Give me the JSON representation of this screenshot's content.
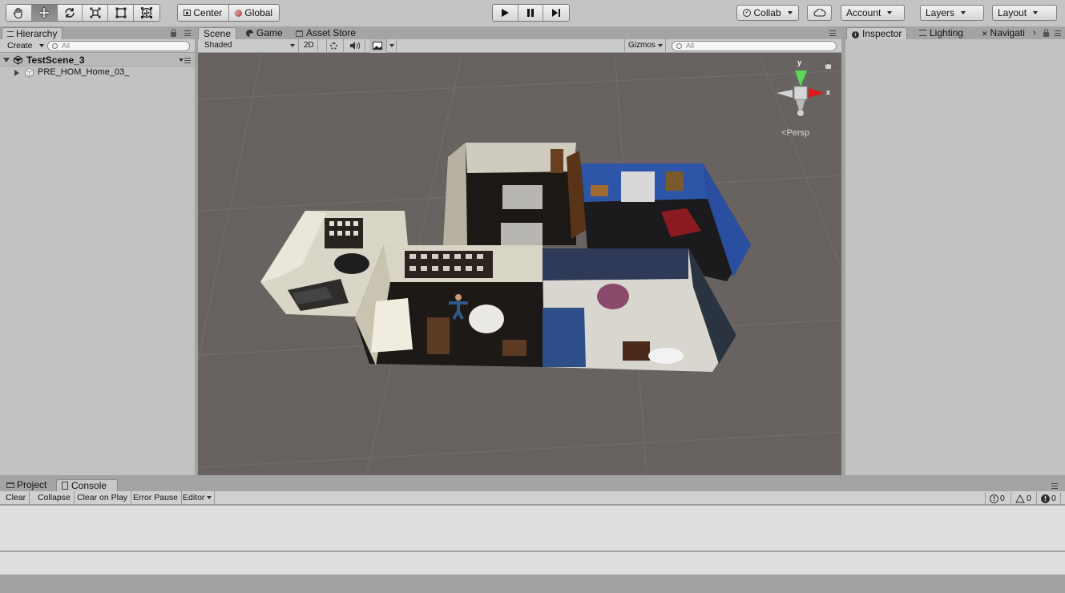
{
  "toolbar": {
    "tools": [
      "hand-tool",
      "move-tool",
      "rotate-tool",
      "scale-tool",
      "rect-tool",
      "transform-tool"
    ],
    "active_tool": "move-tool",
    "pivot_mode": "Center",
    "pivot_rotation": "Global",
    "collab_label": "Collab",
    "account_label": "Account",
    "layers_label": "Layers",
    "layout_label": "Layout"
  },
  "hierarchy": {
    "tab_label": "Hierarchy",
    "create_label": "Create",
    "search_placeholder": "All",
    "scene_name": "TestScene_3",
    "items": [
      {
        "label": "PRE_HOM_Home_03_"
      }
    ]
  },
  "scene_tabs": [
    {
      "label": "Scene",
      "icon": "scene-icon",
      "active": true
    },
    {
      "label": "Game",
      "icon": "game-icon",
      "active": false
    },
    {
      "label": "Asset Store",
      "icon": "asset-store-icon",
      "active": false
    }
  ],
  "scene_toolbar": {
    "shading_mode": "Shaded",
    "mode_2d": "2D",
    "gizmos_label": "Gizmos",
    "search_placeholder": "All"
  },
  "gizmo": {
    "y_label": "y",
    "x_label": "x",
    "projection_label": "Persp"
  },
  "inspector_tabs": [
    {
      "label": "Inspector",
      "active": true
    },
    {
      "label": "Lighting",
      "active": false
    },
    {
      "label": "Navigati",
      "active": false
    }
  ],
  "bottom_tabs": [
    {
      "label": "Project",
      "active": false
    },
    {
      "label": "Console",
      "active": true
    }
  ],
  "console": {
    "clear": "Clear",
    "collapse": "Collapse",
    "clear_on_play": "Clear on Play",
    "error_pause": "Error Pause",
    "editor": "Editor",
    "info_count": "0",
    "warning_count": "0",
    "error_count": "0"
  },
  "colors": {
    "toolbar_bg": "#c4c4c4",
    "panel_bg": "#c2c2c2",
    "viewport_bg": "#686360"
  }
}
